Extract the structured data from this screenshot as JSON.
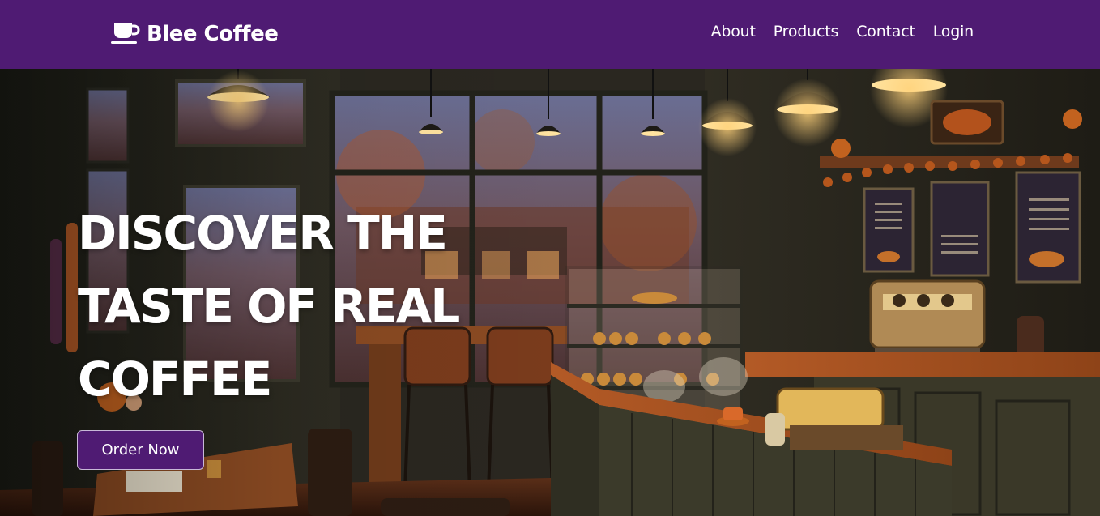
{
  "brand": {
    "name": "Blee Coffee",
    "icon": "coffee-cup-icon"
  },
  "nav": {
    "links": [
      {
        "label": "About"
      },
      {
        "label": "Products"
      },
      {
        "label": "Contact"
      },
      {
        "label": "Login"
      }
    ]
  },
  "hero": {
    "title": "DISCOVER THE TASTE OF REAL COFFEE",
    "cta_label": "Order Now",
    "background_image": "cozy-coffee-shop-interior"
  },
  "colors": {
    "nav_bg": "#4f1b73",
    "button_bg": "#4f1b73",
    "text": "#ffffff"
  }
}
